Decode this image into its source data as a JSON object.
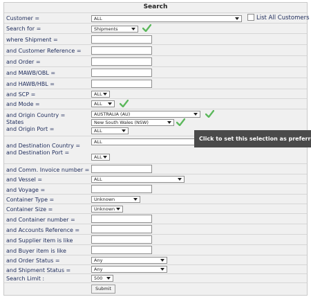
{
  "title": "Search",
  "customer": {
    "label": "Customer =",
    "value": "ALL",
    "list_all_label": "List All Customers"
  },
  "search_for": {
    "label": "Search for =",
    "value": "Shipments"
  },
  "where_shipment": {
    "label": "where Shipment ="
  },
  "customer_reference": {
    "label": "and Customer Reference ="
  },
  "order": {
    "label": "and Order ="
  },
  "mawb": {
    "label": "and MAWB/OBL ="
  },
  "hawb": {
    "label": "and HAWB/HBL ="
  },
  "scp": {
    "label": "and SCP =",
    "value": "ALL"
  },
  "mode": {
    "label": "and Mode =",
    "value": "ALL"
  },
  "origin_country": {
    "label": "and Origin Country =",
    "value": "AUSTRALIA (AU)"
  },
  "states": {
    "label": "States",
    "value": "New South Wales (NSW)"
  },
  "origin_port": {
    "label": "and Origin Port =",
    "value": "ALL"
  },
  "destination_country": {
    "label": "and Destination Country =",
    "value": "ALL"
  },
  "destination_port": {
    "label": "and Destination Port =",
    "value": "ALL"
  },
  "comm_invoice": {
    "label": "and Comm. Invoice number ="
  },
  "vessel": {
    "label": "and Vessel =",
    "value": "ALL"
  },
  "voyage": {
    "label": "and Voyage ="
  },
  "container_type": {
    "label": "Container Type =",
    "value": "Unknown"
  },
  "container_size": {
    "label": "Container Size =",
    "value": "Unknown"
  },
  "container_number": {
    "label": "and Container number ="
  },
  "accounts_reference": {
    "label": "and Accounts Reference ="
  },
  "supplier_item": {
    "label": "and Supplier item is like"
  },
  "buyer_item": {
    "label": "and Buyer item is like"
  },
  "order_status": {
    "label": "and Order Status =",
    "value": "Any"
  },
  "shipment_status": {
    "label": "and Shipment Status =",
    "value": "Any"
  },
  "search_limit": {
    "label": "Search Limit :",
    "value": "500"
  },
  "submit_label": "Submit",
  "tooltip_text": "Click to set this selection as preferred",
  "colors": {
    "label_text": "#1c2a5a",
    "check_green": "#5cb85c",
    "tooltip_bg": "#4a4a4a"
  }
}
